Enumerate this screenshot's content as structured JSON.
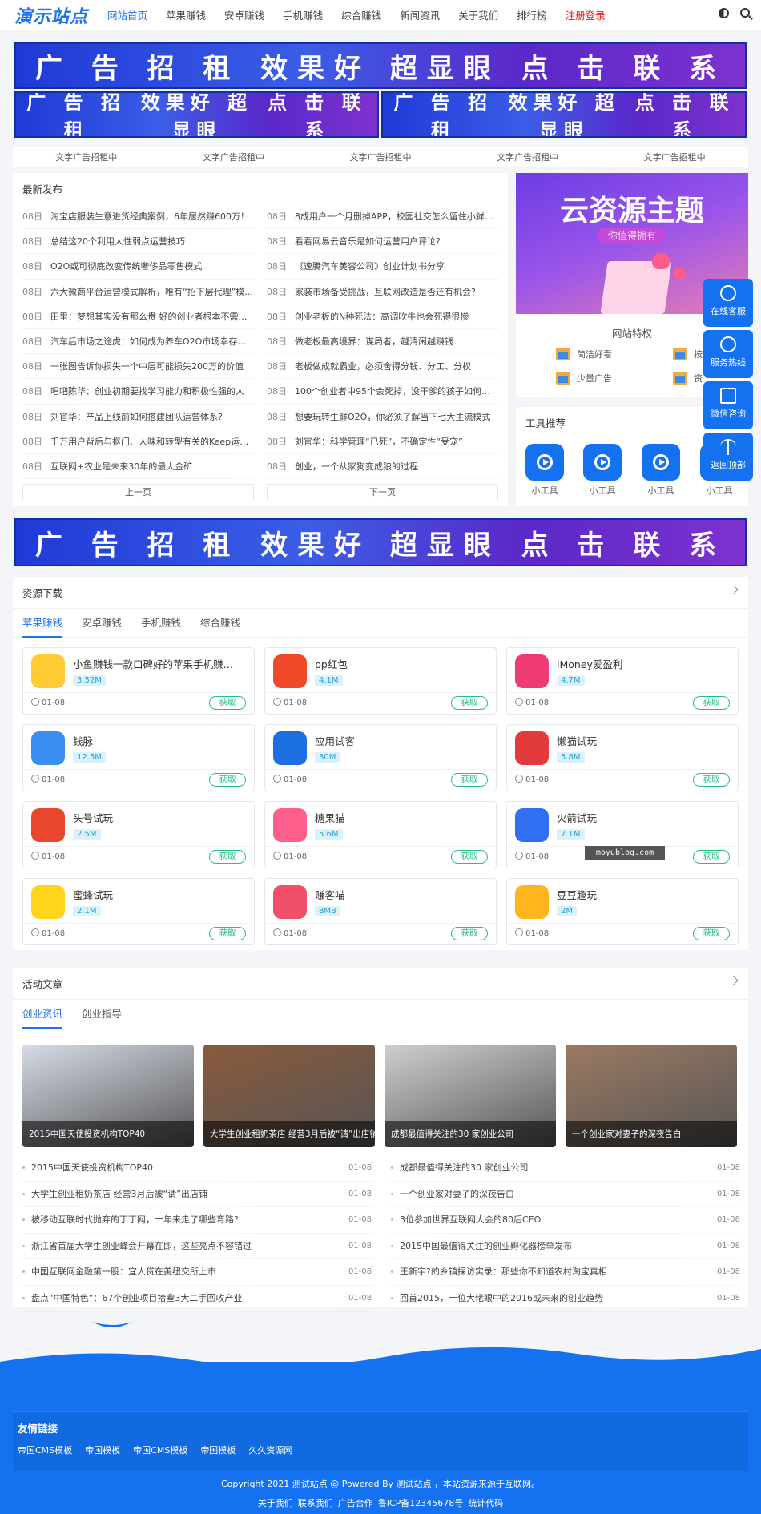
{
  "header": {
    "logo": "演示站点",
    "nav": [
      "网站首页",
      "苹果赚钱",
      "安卓赚钱",
      "手机赚钱",
      "综合赚钱",
      "新闻资讯",
      "关于我们",
      "排行榜",
      "注册登录"
    ]
  },
  "banner_big": [
    "广 告 招 租",
    "效果好 超显眼",
    "点 击 联 系"
  ],
  "banner_small": [
    "广 告 招 租",
    "效果好 超显眼",
    "点 击 联 系"
  ],
  "text_ads": [
    "文字广告招租中",
    "文字广告招租中",
    "文字广告招租中",
    "文字广告招租中",
    "文字广告招租中"
  ],
  "latest": {
    "title": "最新发布",
    "items": [
      {
        "d": "08日",
        "t": "淘宝店服装生意进货经典案例，6年居然赚600万！"
      },
      {
        "d": "08日",
        "t": "8成用户一个月删掉APP，校园社交怎么留住小鲜肉..."
      },
      {
        "d": "08日",
        "t": "总结这20个利用人性弱点运营技巧"
      },
      {
        "d": "08日",
        "t": "看看网易云音乐是如何运营用户评论?"
      },
      {
        "d": "08日",
        "t": "O2O或可彻底改变传统奢侈品零售模式"
      },
      {
        "d": "08日",
        "t": "《速腾汽车美容公司》创业计划书分享"
      },
      {
        "d": "08日",
        "t": "六大微商平台运营模式解析，唯有“招下层代理”模..."
      },
      {
        "d": "08日",
        "t": "家装市场备受挑战，互联网改造是否还有机会?"
      },
      {
        "d": "08日",
        "t": "田里：梦想其实没有那么贵 好的创业者根本不需要..."
      },
      {
        "d": "08日",
        "t": "创业老板的N种死法：高调吹牛也会死得很惨"
      },
      {
        "d": "08日",
        "t": "汽车后市场之途虎：如何成为养车O2O市场幸存者的"
      },
      {
        "d": "08日",
        "t": "做老板最高境界：谋局者，越清闲越赚钱"
      },
      {
        "d": "08日",
        "t": "一张图告诉你损失一个中层可能损失200万的价值"
      },
      {
        "d": "08日",
        "t": "老板做成就霸业，必须舍得分钱、分工、分权"
      },
      {
        "d": "08日",
        "t": "唱吧陈华：创业初期要找学习能力和积极性强的人"
      },
      {
        "d": "08日",
        "t": "100个创业者中95个会死掉，没干爹的孩子如何避免..."
      },
      {
        "d": "08日",
        "t": "刘官华：产品上线前如何搭建团队运营体系?"
      },
      {
        "d": "08日",
        "t": "想要玩转生鲜O2O，你必须了解当下七大主流模式"
      },
      {
        "d": "08日",
        "t": "千万用户背后与抠门、人味和转型有关的Keep运营..."
      },
      {
        "d": "08日",
        "t": "刘官华：科学管理“已死”，不确定性“受宠”"
      },
      {
        "d": "08日",
        "t": "互联网+农业是未来30年的最大金矿"
      },
      {
        "d": "08日",
        "t": "创业，一个从家狗变成狼的过程"
      }
    ],
    "prev": "上一页",
    "next": "下一页"
  },
  "promo": {
    "title": "云资源主题",
    "subtitle": "你值得拥有"
  },
  "features": {
    "title": "网站特权",
    "items": [
      "简洁好看",
      "按",
      "少量广告",
      "资"
    ]
  },
  "tools": {
    "title": "工具推荐",
    "items": [
      "小工具",
      "小工具",
      "小工具",
      "小工具"
    ]
  },
  "float": [
    "在线客服",
    "服务热线",
    "微信咨询",
    "返回顶部"
  ],
  "resources": {
    "title": "资源下载",
    "tabs": [
      "苹果赚钱",
      "安卓赚钱",
      "手机赚钱",
      "综合赚钱"
    ],
    "get_label": "获取",
    "items": [
      {
        "name": "小鱼赚钱一款口碑好的苹果手机赚钱...",
        "size": "3.52M",
        "date": "01-08",
        "color": "#ffcc33"
      },
      {
        "name": "pp红包",
        "size": "4.1M",
        "date": "01-08",
        "color": "#f04a2a"
      },
      {
        "name": "iMoney爱盈利",
        "size": "4.7M",
        "date": "01-08",
        "color": "#ee3b73"
      },
      {
        "name": "钱脉",
        "size": "12.5M",
        "date": "01-08",
        "color": "#3a8ef0"
      },
      {
        "name": "应用试客",
        "size": "30M",
        "date": "01-08",
        "color": "#1b6fe0"
      },
      {
        "name": "懒猫试玩",
        "size": "5.8M",
        "date": "01-08",
        "color": "#e23a3a"
      },
      {
        "name": "头号试玩",
        "size": "2.5M",
        "date": "01-08",
        "color": "#e8472e"
      },
      {
        "name": "糖果猫",
        "size": "5.6M",
        "date": "01-08",
        "color": "#ff5f8d"
      },
      {
        "name": "火箭试玩",
        "size": "7.1M",
        "date": "01-08",
        "color": "#2f6ff0"
      },
      {
        "name": "蜜蜂试玩",
        "size": "2.1M",
        "date": "01-08",
        "color": "#ffd41c"
      },
      {
        "name": "赚客喵",
        "size": "8MB",
        "date": "01-08",
        "color": "#f0506a"
      },
      {
        "name": "豆豆趣玩",
        "size": "2M",
        "date": "01-08",
        "color": "#ffb51c"
      }
    ]
  },
  "watermark": "moyublog.com",
  "activity": {
    "title": "活动文章",
    "tabs": [
      "创业资讯",
      "创业指导"
    ],
    "thumbs": [
      {
        "cap": "2015中国天使投资机构TOP40",
        "color": "#d6dbe6"
      },
      {
        "cap": "大学生创业租奶茶店 经营3月后被“请”出店铺",
        "color": "#8a5a3c"
      },
      {
        "cap": "成都最值得关注的30 家创业公司",
        "color": "#cfcfcf"
      },
      {
        "cap": "一个创业家对妻子的深夜告白",
        "color": "#9b7a62"
      }
    ],
    "left": [
      {
        "t": "2015中国天使投资机构TOP40",
        "d": "01-08"
      },
      {
        "t": "大学生创业租奶茶店 经营3月后被“请”出店铺",
        "d": "01-08"
      },
      {
        "t": "被移动互联时代抛弃的丁丁网，十年来走了哪些弯路?",
        "d": "01-08"
      },
      {
        "t": "浙江省首届大学生创业峰会开幕在即，这些亮点不容错过",
        "d": "01-08"
      },
      {
        "t": "中国互联网金融第一股：宜人贷在美纽交所上市",
        "d": "01-08"
      },
      {
        "t": "盘点“中国特色”：67个创业项目拾叁3大二手回收产业",
        "d": "01-08"
      }
    ],
    "right": [
      {
        "t": "成都最值得关注的30 家创业公司",
        "d": "01-08"
      },
      {
        "t": "一个创业家对妻子的深夜告白",
        "d": "01-08"
      },
      {
        "t": "3位参加世界互联网大会的80后CEO",
        "d": "01-08"
      },
      {
        "t": "2015中国最值得关注的创业孵化器榜单发布",
        "d": "01-08"
      },
      {
        "t": "王新宇?的乡镇探访实录：那些你不知道农村淘宝真相",
        "d": "01-08"
      },
      {
        "t": "回首2015，十位大佬眼中的2016或未来的创业趋势",
        "d": "01-08"
      }
    ]
  },
  "footer": {
    "links_title": "友情链接",
    "links": [
      "帝国CMS模板",
      "帝国模板",
      "帝国CMS模板",
      "帝国模板",
      "久久资源网"
    ],
    "copyright": "Copyright 2021 测试站点 @ Powered By 测试站点 ，本站资源来源于互联网。",
    "bottom_links": [
      "关于我们",
      "联系我们",
      "广告合作",
      "鲁ICP备12345678号",
      "统计代码"
    ]
  }
}
